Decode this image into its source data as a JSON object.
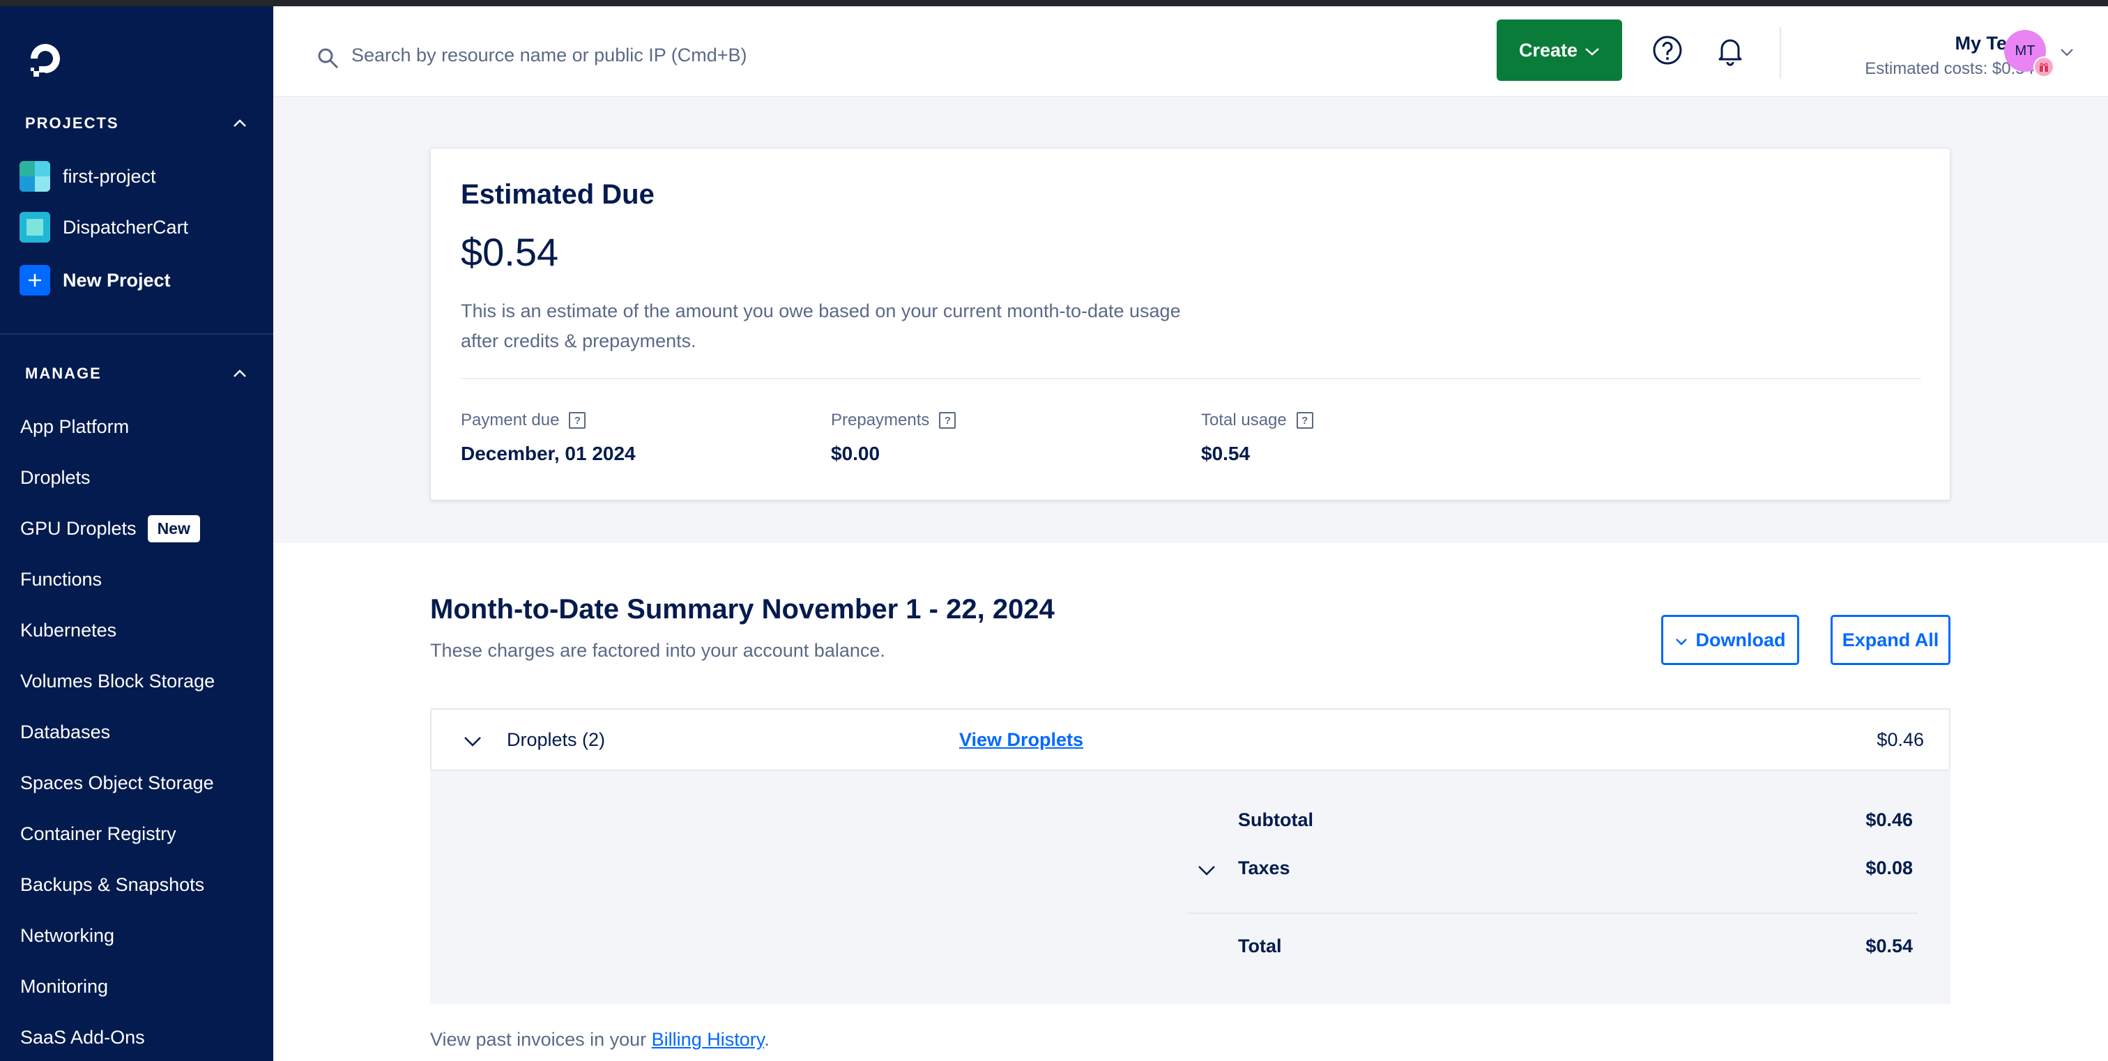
{
  "sidebar": {
    "projects_heading": "PROJECTS",
    "projects": [
      {
        "label": "first-project"
      },
      {
        "label": "DispatcherCart"
      }
    ],
    "new_project_label": "New Project",
    "manage_heading": "MANAGE",
    "nav": [
      {
        "label": "App Platform"
      },
      {
        "label": "Droplets"
      },
      {
        "label": "GPU Droplets",
        "badge": "New"
      },
      {
        "label": "Functions"
      },
      {
        "label": "Kubernetes"
      },
      {
        "label": "Volumes Block Storage"
      },
      {
        "label": "Databases"
      },
      {
        "label": "Spaces Object Storage"
      },
      {
        "label": "Container Registry"
      },
      {
        "label": "Backups & Snapshots"
      },
      {
        "label": "Networking"
      },
      {
        "label": "Monitoring"
      },
      {
        "label": "SaaS Add-Ons"
      }
    ]
  },
  "header": {
    "search_placeholder": "Search by resource name or public IP (Cmd+B)",
    "create_label": "Create",
    "team_name": "My Team",
    "estimated_costs": "Estimated costs: $0.54",
    "avatar_initials": "MT"
  },
  "estimate": {
    "title": "Estimated Due",
    "amount": "$0.54",
    "description": "This is an estimate of the amount you owe based on your current month-to-date usage after credits & prepayments.",
    "payment_due_label": "Payment due",
    "payment_due_value": "December, 01 2024",
    "prepayments_label": "Prepayments",
    "prepayments_value": "$0.00",
    "total_usage_label": "Total usage",
    "total_usage_value": "$0.54",
    "help_glyph": "?"
  },
  "summary": {
    "title": "Month-to-Date Summary November 1 - 22, 2024",
    "subtitle": "These charges are factored into your account balance.",
    "download_label": "Download",
    "expand_all_label": "Expand All",
    "droplets_label": "Droplets (2)",
    "view_droplets_label": "View Droplets",
    "droplets_amount": "$0.46",
    "subtotal_label": "Subtotal",
    "subtotal_value": "$0.46",
    "taxes_label": "Taxes",
    "taxes_value": "$0.08",
    "total_label": "Total",
    "total_value": "$0.54",
    "past_invoices_prefix": "View past invoices in your ",
    "billing_history_label": "Billing History",
    "past_invoices_suffix": "."
  },
  "colors": {
    "sidebar_bg": "#031b4e",
    "brand_blue": "#0069ff",
    "create_green": "#0a7c3a",
    "avatar_pink": "#e984f4"
  },
  "icons": [
    "digitalocean-logo-icon",
    "search-icon",
    "chevron-down-icon",
    "help-icon",
    "bell-icon",
    "chevron-up-icon",
    "plus-icon"
  ]
}
